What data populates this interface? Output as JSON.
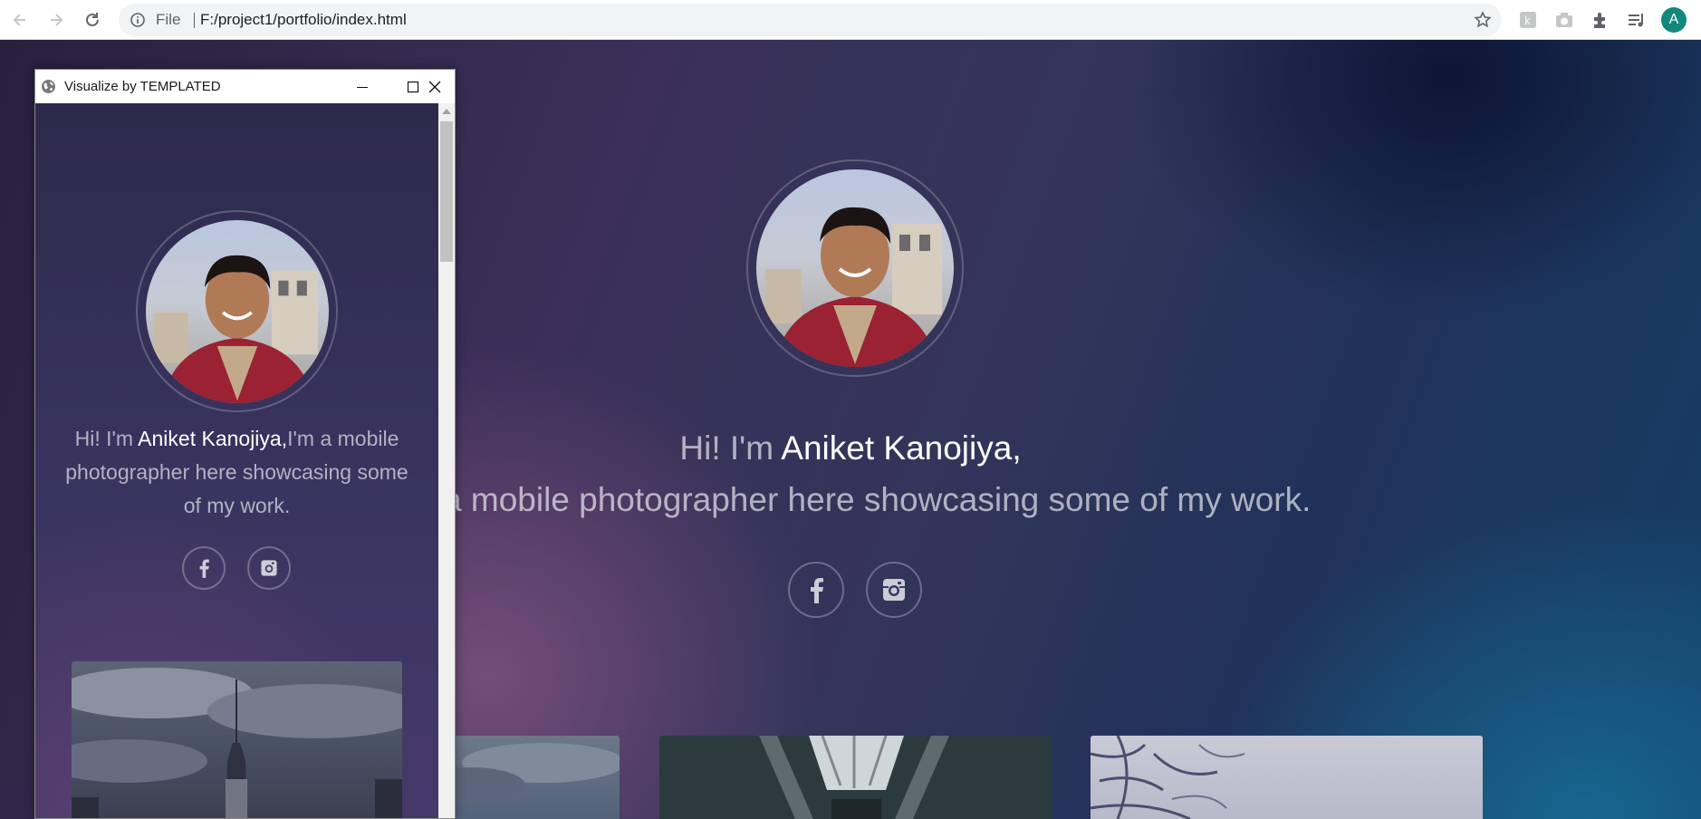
{
  "browser": {
    "back_icon": "arrow-left-icon",
    "forward_icon": "arrow-right-icon",
    "reload_icon": "reload-icon",
    "omnibox": {
      "info_icon": "info-icon",
      "scheme_label": "File",
      "url": "F:/project1/portfolio/index.html",
      "star_icon": "star-icon"
    },
    "toolbar_icons": [
      "extension-icon",
      "camera-icon",
      "puzzle-icon",
      "media-queue-icon"
    ],
    "profile_initial": "A",
    "colors": {
      "profile_bg": "#12877c"
    }
  },
  "page": {
    "greeting_prefix": "Hi! I'm ",
    "name": "Aniket Kanojiya,",
    "tagline": "I'm a mobile photographer here showcasing some of my work.",
    "social": [
      {
        "icon": "facebook-icon"
      },
      {
        "icon": "instagram-icon"
      }
    ],
    "gallery": [
      {
        "icon": "city-photo-thumbnail"
      },
      {
        "icon": "corridor-photo-thumbnail"
      },
      {
        "icon": "snowy-tree-photo-thumbnail"
      }
    ]
  },
  "popup": {
    "globe_icon": "globe-icon",
    "title": "Visualize by TEMPLATED",
    "greeting_prefix": "Hi! I'm ",
    "name": "Aniket Kanojiya,",
    "tagline": "I'm a mobile photographer here showcasing some of my work.",
    "window_icons": [
      "minimize-icon",
      "maximize-icon",
      "close-icon"
    ]
  }
}
